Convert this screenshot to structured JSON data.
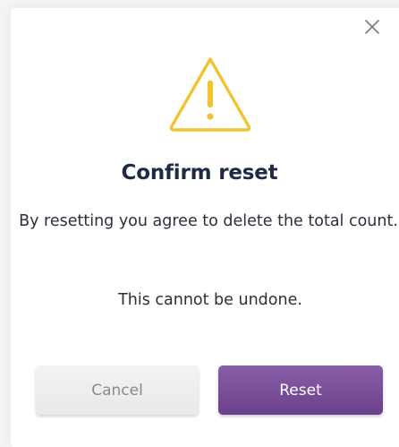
{
  "dialog": {
    "title": "Confirm reset",
    "message": "By resetting you agree to delete the total count.",
    "note": "This cannot be undone.",
    "cancel_label": "Cancel",
    "reset_label": "Reset",
    "close_icon": "close-icon",
    "warning_icon": "warning-triangle-icon"
  },
  "colors": {
    "warning": "#f2c230",
    "primary": "#7a4f9c",
    "title": "#1f2a44"
  }
}
